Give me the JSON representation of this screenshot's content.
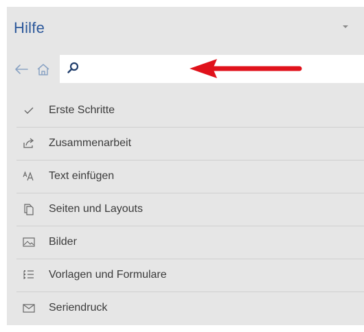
{
  "pane": {
    "title": "Hilfe"
  },
  "search": {
    "value": "",
    "placeholder": ""
  },
  "menu": {
    "items": [
      {
        "label": "Erste Schritte",
        "icon": "checkmark-icon"
      },
      {
        "label": "Zusammenarbeit",
        "icon": "share-icon"
      },
      {
        "label": "Text einfügen",
        "icon": "font-size-icon"
      },
      {
        "label": "Seiten und Layouts",
        "icon": "pages-icon"
      },
      {
        "label": "Bilder",
        "icon": "picture-icon"
      },
      {
        "label": "Vorlagen und Formulare",
        "icon": "list-icon"
      },
      {
        "label": "Seriendruck",
        "icon": "envelope-icon"
      }
    ]
  },
  "colors": {
    "title": "#2b579a",
    "pane_background": "#e6e6e6",
    "annotation_arrow": "#e0121b",
    "text": "#3b3b3b"
  }
}
